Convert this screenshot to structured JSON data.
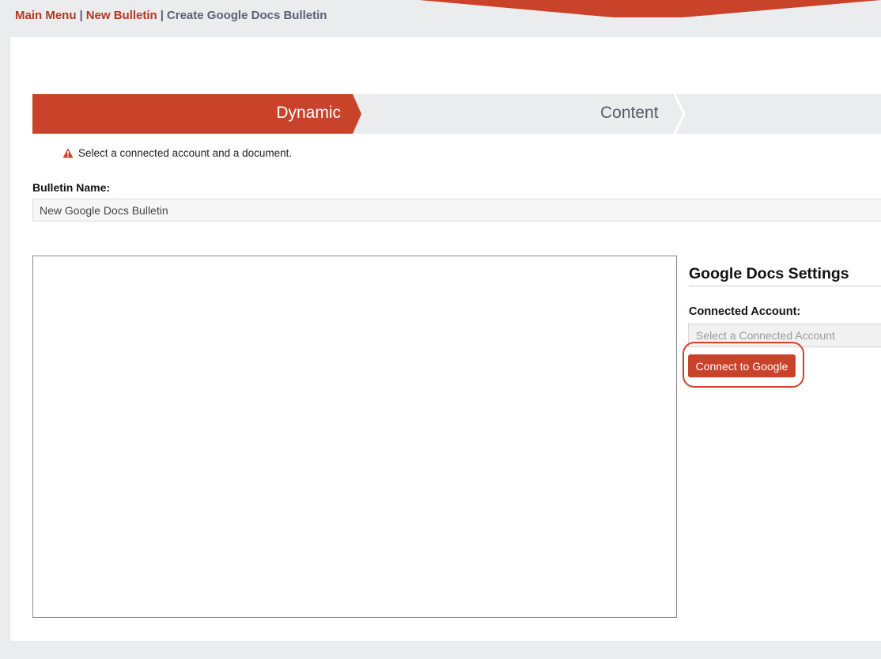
{
  "breadcrumb": {
    "main_menu": "Main Menu",
    "new_bulletin": "New Bulletin",
    "current": "Create Google Docs Bulletin",
    "separator": "|"
  },
  "steps": {
    "active": "Dynamic",
    "next": "Content"
  },
  "warning": {
    "icon": "warning-icon",
    "text": "Select a connected account and a document."
  },
  "bulletin": {
    "label": "Bulletin Name:",
    "value": "New Google Docs Bulletin"
  },
  "settings": {
    "title": "Google Docs Settings",
    "account_label": "Connected Account:",
    "account_placeholder": "Select a Connected Account",
    "connect_button": "Connect to Google"
  },
  "colors": {
    "accent": "#c9432a",
    "background": "#ebecee",
    "panel": "#ffffff"
  }
}
